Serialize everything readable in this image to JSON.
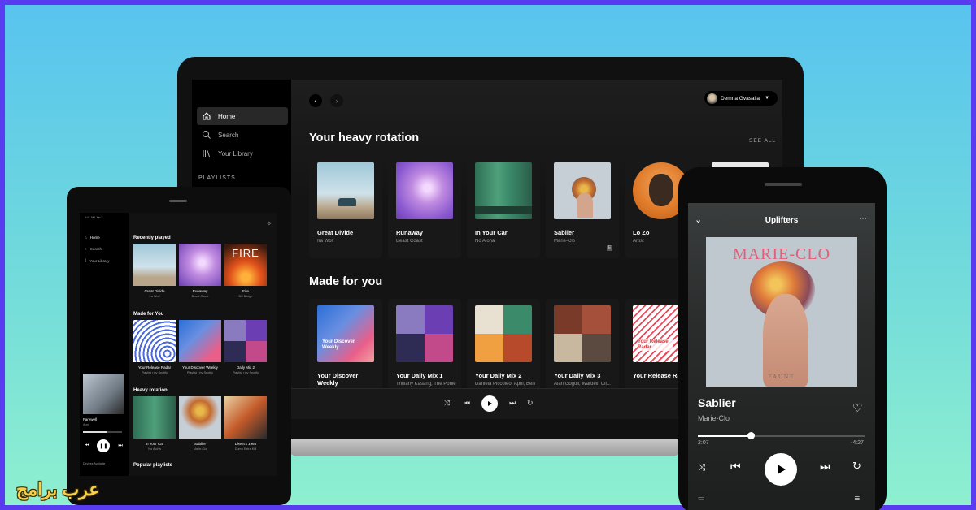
{
  "laptop": {
    "nav": [
      {
        "label": "Home",
        "icon": "home-icon",
        "active": true
      },
      {
        "label": "Search",
        "icon": "search-icon",
        "active": false
      },
      {
        "label": "Your Library",
        "icon": "library-icon",
        "active": false
      }
    ],
    "playlists_heading": "PLAYLISTS",
    "user_name": "Demna Gvasalia",
    "heavy_rotation": {
      "title": "Your heavy rotation",
      "see_all": "SEE ALL",
      "cards": [
        {
          "title": "Great Divide",
          "subtitle": "Ira Wolf",
          "explicit": false
        },
        {
          "title": "Runaway",
          "subtitle": "Beast Coast",
          "explicit": false
        },
        {
          "title": "In Your Car",
          "subtitle": "No Aloha",
          "explicit": false
        },
        {
          "title": "Sablier",
          "subtitle": "Marie-Clo",
          "explicit": true
        },
        {
          "title": "Lo Zo",
          "subtitle": "Artist",
          "explicit": false
        }
      ]
    },
    "made_for_you": {
      "title": "Made for you",
      "cards": [
        {
          "title": "Your Discover Weekly",
          "subtitle": "",
          "art_text": "Your Discover Weekly"
        },
        {
          "title": "Your Daily Mix 1",
          "subtitle": "Thiflany Kasang, The Ponies, ..."
        },
        {
          "title": "Your Daily Mix 2",
          "subtitle": "Daniela Piccoleo, April, Belle..."
        },
        {
          "title": "Your Daily Mix 3",
          "subtitle": "Alan Gogoll, Wardell, Cil..."
        },
        {
          "title": "Your Release Radar",
          "subtitle": "",
          "art_text": "Your Release Radar"
        }
      ]
    }
  },
  "tablet": {
    "status_time": "9:41 AM Jun 3",
    "nav": [
      "Home",
      "Search",
      "Your Library"
    ],
    "recently_played": {
      "title": "Recently played",
      "cards": [
        {
          "title": "Great Divide",
          "subtitle": "Ira Wolf"
        },
        {
          "title": "Runaway",
          "subtitle": "Beast Coast"
        },
        {
          "title": "Fire",
          "subtitle": "Bill Bridge"
        }
      ]
    },
    "made_for_you": {
      "title": "Made for You",
      "cards": [
        {
          "title": "Your Release Radar",
          "subtitle": "Playlist • by Spotify"
        },
        {
          "title": "Your Discover Weekly",
          "subtitle": "Playlist • by Spotify"
        },
        {
          "title": "Daily Mix 2",
          "subtitle": "Playlist • by Spotify"
        }
      ]
    },
    "heavy_rotation": {
      "title": "Heavy rotation",
      "cards": [
        {
          "title": "In Your Car",
          "subtitle": "No Aloha"
        },
        {
          "title": "Sablier",
          "subtitle": "Marie-Clo"
        },
        {
          "title": "Like It's 1965",
          "subtitle": "Dumb Extra Kid"
        }
      ]
    },
    "popular_playlists_title": "Popular playlists",
    "now_playing": {
      "title": "Farewell",
      "artist": "April",
      "progress": 0.6
    },
    "devices_label": "Devices Available",
    "fire_art_text": "FIRE"
  },
  "phone": {
    "playlist_title": "Uplifters",
    "album_text_top": "MARIE-CLO",
    "album_text_bottom": "FAUNE",
    "song": "Sablier",
    "artist": "Marie-Clo",
    "elapsed": "2:07",
    "remaining": "-4:27",
    "progress": 0.32
  },
  "watermark": "عرب برامج",
  "colors": {
    "accent_border": "#5a3cf0",
    "spotify_bg": "#121212"
  }
}
